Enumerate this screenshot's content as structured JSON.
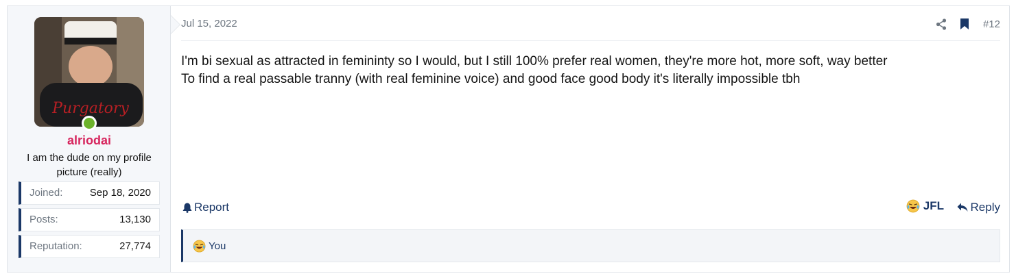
{
  "user": {
    "username": "alriodai",
    "title": "I am the dude on my profile picture (really)",
    "online": true,
    "avatar_text": "Purgatory",
    "stats": [
      {
        "label": "Joined:",
        "value": "Sep 18, 2020"
      },
      {
        "label": "Posts:",
        "value": "13,130"
      },
      {
        "label": "Reputation:",
        "value": "27,774"
      }
    ]
  },
  "post": {
    "date": "Jul 15, 2022",
    "number": "#12",
    "lines": [
      "I'm bi sexual as attracted in femininty so I would, but I still 100% prefer real women, they're more hot, more soft, way better",
      "To find a real passable tranny (with real feminine voice) and good face good body it's literally impossible tbh"
    ],
    "report_label": "Report",
    "reaction_label": "JFL",
    "reply_label": "Reply",
    "reacted_by": "You"
  },
  "colors": {
    "accent": "#1b3867",
    "username": "#d7265e",
    "online": "#6cb32b"
  },
  "icons": {
    "share": "share-icon",
    "bookmark": "bookmark-icon",
    "report": "bell-icon",
    "reply": "reply-arrow-icon",
    "reaction": "crying-laughing-emoji-icon"
  }
}
